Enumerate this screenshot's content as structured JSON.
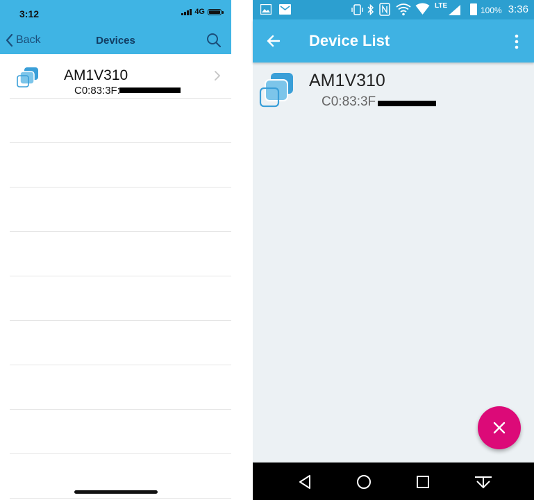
{
  "ios": {
    "status": {
      "time": "3:12",
      "network": "4G"
    },
    "nav": {
      "back_label": "Back",
      "title": "Devices"
    },
    "devices": [
      {
        "name": "AM1V310",
        "mac": "C0:83:3F:"
      }
    ],
    "colors": {
      "header": "#3fb4e4",
      "title": "#123d63"
    }
  },
  "android": {
    "status": {
      "battery": "100%",
      "time": "3:36",
      "network": "LTE"
    },
    "toolbar": {
      "title": "Device List"
    },
    "devices": [
      {
        "name": "AM1V310",
        "mac": "C0:83:3F"
      }
    ],
    "colors": {
      "toolbar": "#3fb2e3",
      "fab": "#dc0a78",
      "background": "#ecf1f4"
    }
  }
}
